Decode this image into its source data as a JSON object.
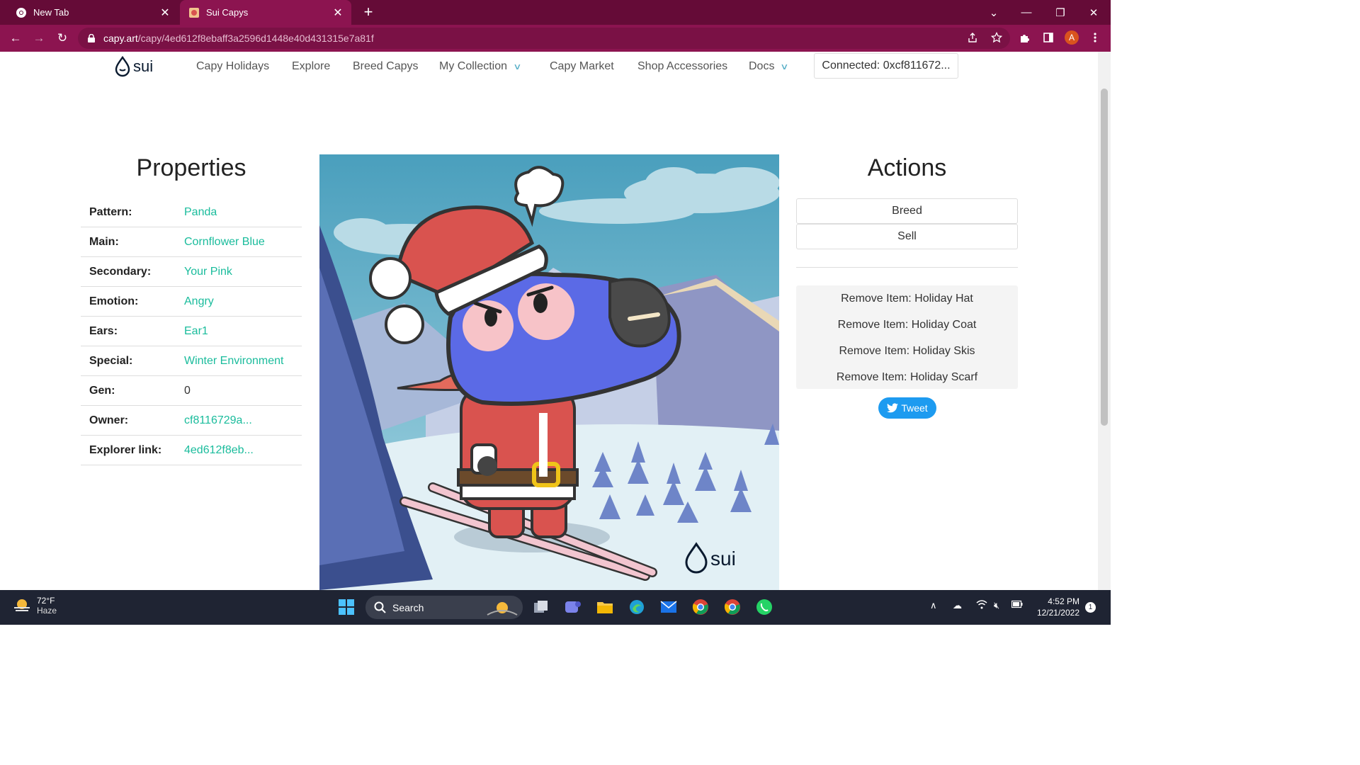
{
  "browser": {
    "tabs": [
      {
        "title": "New Tab",
        "active": false
      },
      {
        "title": "Sui Capys",
        "active": true
      }
    ],
    "url_host": "capy.art",
    "url_path": "/capy/4ed612f8ebaff3a2596d1448e40d431315e7a81f",
    "profile_initial": "A"
  },
  "site": {
    "logo_text": "sui",
    "nav": [
      {
        "label": "Capy Holidays"
      },
      {
        "label": "Explore"
      },
      {
        "label": "Breed Capys"
      },
      {
        "label": "My Collection"
      },
      {
        "label": "Capy Market"
      },
      {
        "label": "Shop Accessories"
      },
      {
        "label": "Docs"
      }
    ],
    "connected_label": "Connected: 0xcf811672..."
  },
  "properties": {
    "title": "Properties",
    "rows": [
      {
        "key": "Pattern:",
        "value": "Panda"
      },
      {
        "key": "Main:",
        "value": "Cornflower Blue"
      },
      {
        "key": "Secondary:",
        "value": "Your Pink"
      },
      {
        "key": "Emotion:",
        "value": "Angry"
      },
      {
        "key": "Ears:",
        "value": "Ear1"
      },
      {
        "key": "Special:",
        "value": "Winter Environment"
      },
      {
        "key": "Gen:",
        "value": "0"
      },
      {
        "key": "Owner:",
        "value": "cf8116729a..."
      },
      {
        "key": "Explorer link:",
        "value": "4ed612f8eb..."
      }
    ]
  },
  "artwork": {
    "watermark_text": "sui"
  },
  "actions": {
    "title": "Actions",
    "breed_label": "Breed",
    "sell_label": "Sell",
    "remove_items": [
      "Remove Item: Holiday Hat",
      "Remove Item: Holiday Coat",
      "Remove Item: Holiday Skis",
      "Remove Item: Holiday Scarf"
    ],
    "tweet_label": "Tweet"
  },
  "taskbar": {
    "weather_temp": "72°F",
    "weather_desc": "Haze",
    "search_label": "Search",
    "time": "4:52 PM",
    "date": "12/21/2022",
    "notification_count": "1"
  },
  "colors": {
    "chrome_dark": "#650b37",
    "chrome_tab": "#8c1450",
    "link_teal": "#1abc9c",
    "tweet_blue": "#1d9bf0",
    "capy_blue": "#5b6ae6"
  }
}
